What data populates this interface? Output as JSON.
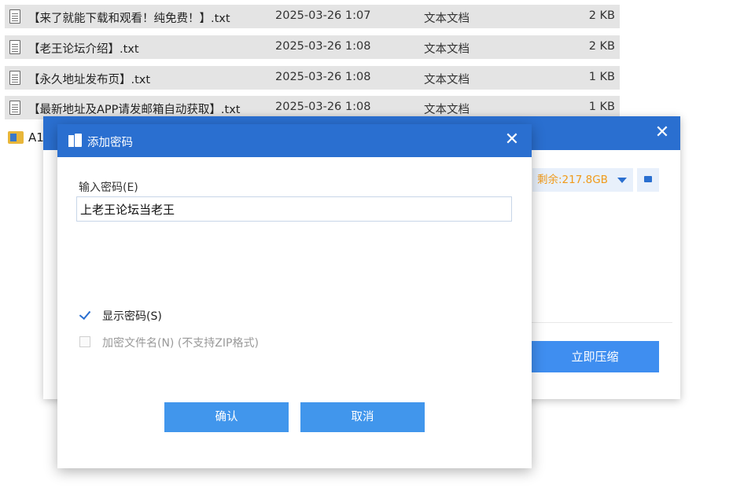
{
  "files": [
    {
      "name": "【来了就能下载和观看！纯免费！】.txt",
      "date": "2025-03-26 1:07",
      "type": "文本文档",
      "size": "2 KB"
    },
    {
      "name": "【老王论坛介绍】.txt",
      "date": "2025-03-26 1:08",
      "type": "文本文档",
      "size": "2 KB"
    },
    {
      "name": "【永久地址发布页】.txt",
      "date": "2025-03-26 1:08",
      "type": "文本文档",
      "size": "1 KB"
    },
    {
      "name": "【最新地址及APP请发邮箱自动获取】.txt",
      "date": "2025-03-26 1:08",
      "type": "文本文档",
      "size": "1 KB"
    }
  ],
  "folder_row": {
    "label": "A1",
    "icon": "archive-folder-icon"
  },
  "compress_window": {
    "free_space": "剩余:217.8GB",
    "compress_button": "立即压缩",
    "accent_color": "#2a6fd0"
  },
  "dialog": {
    "title": "添加密码",
    "password_label": "输入密码(E)",
    "password_value": "上老王论坛当老王",
    "show_password_label": "显示密码(S)",
    "show_password_checked": true,
    "encrypt_filename_label": "加密文件名(N) (不支持ZIP格式)",
    "encrypt_filename_checked": false,
    "confirm_button": "确认",
    "cancel_button": "取消",
    "close_icon": "close-icon"
  }
}
